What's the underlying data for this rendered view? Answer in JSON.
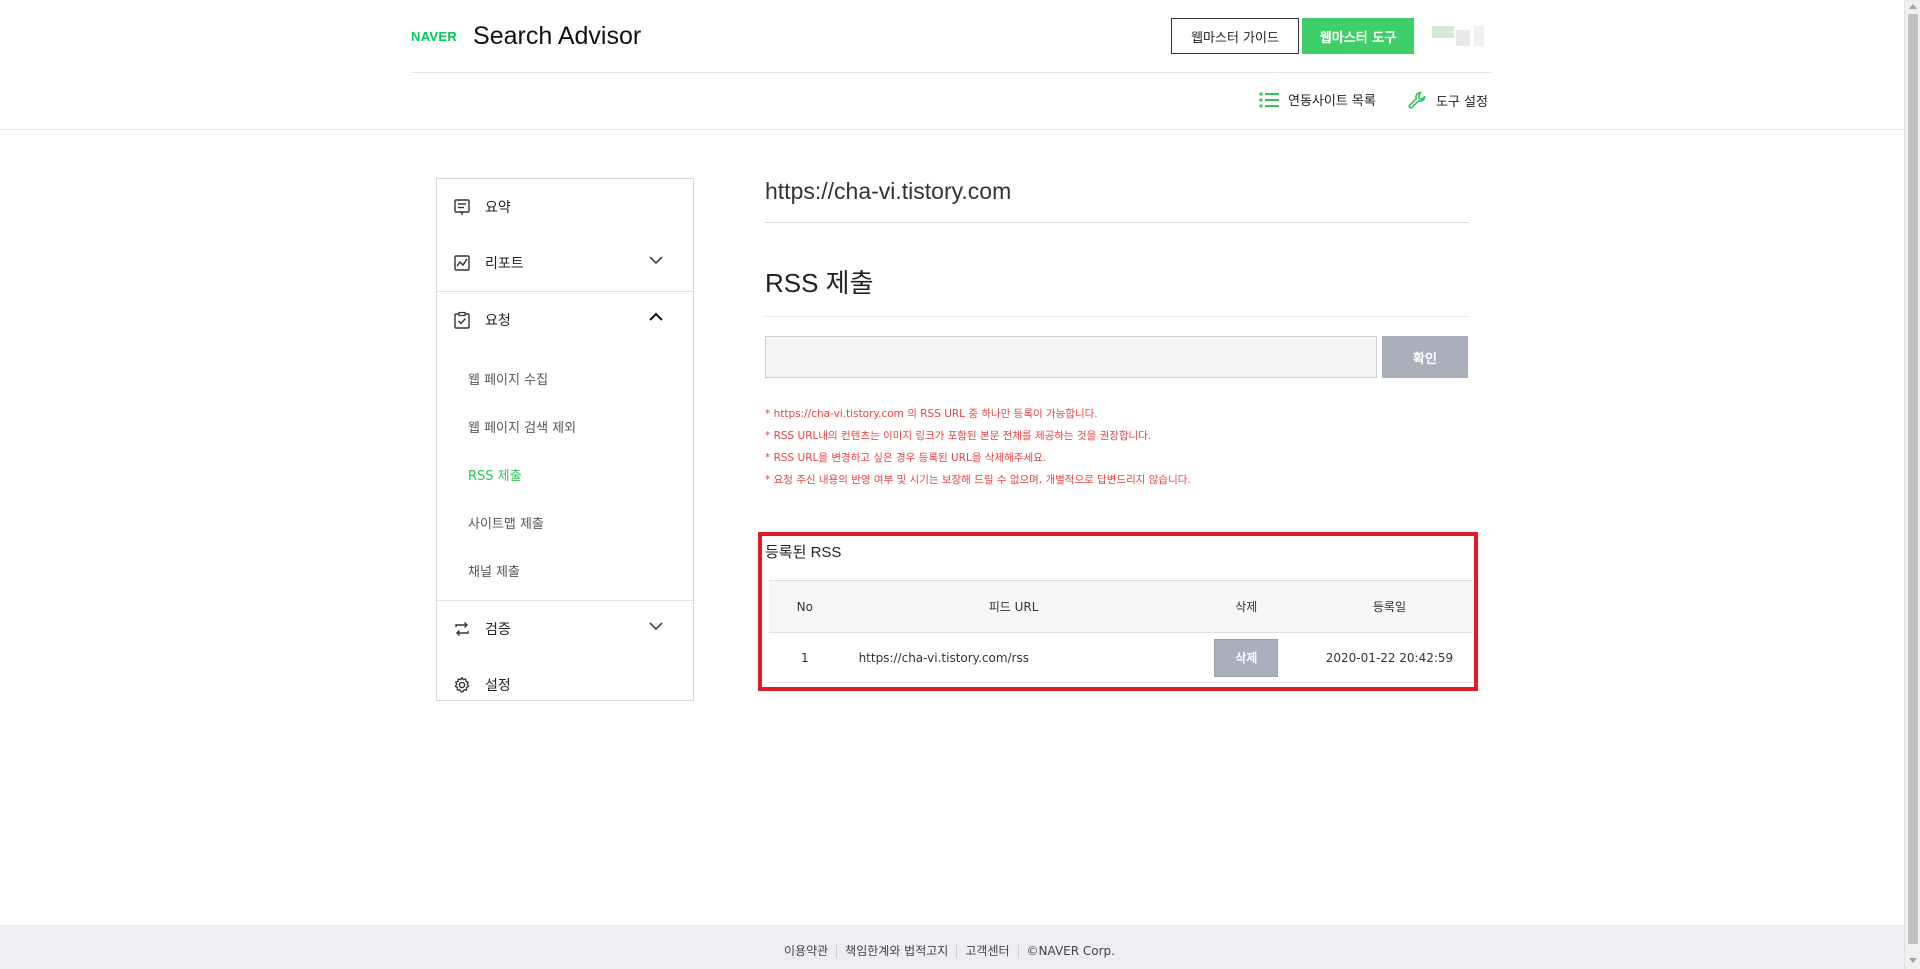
{
  "header": {
    "logo_text": "NAVER",
    "app_title": "Search Advisor",
    "guide_button": "웹마스터 가이드",
    "tools_button": "웹마스터 도구",
    "sites_link": "연동사이트 목록",
    "settings_link": "도구 설정"
  },
  "sidebar": {
    "items": [
      {
        "label": "요약",
        "icon": "summary-icon"
      },
      {
        "label": "리포트",
        "icon": "report-icon"
      },
      {
        "label": "요청",
        "icon": "request-icon"
      },
      {
        "label": "검증",
        "icon": "verify-icon"
      },
      {
        "label": "설정",
        "icon": "gear-icon"
      }
    ],
    "sub_items": [
      {
        "label": "웹 페이지 수집"
      },
      {
        "label": "웹 페이지 검색 제외"
      },
      {
        "label": "RSS 제출"
      },
      {
        "label": "사이트맵 제출"
      },
      {
        "label": "채널 제출"
      }
    ]
  },
  "main": {
    "site_url": "https://cha-vi.tistory.com",
    "page_title": "RSS 제출",
    "input_value": "",
    "confirm_button": "확인",
    "notes": [
      "* https://cha-vi.tistory.com 의 RSS URL 중 하나만 등록이 가능합니다.",
      "* RSS URL내의 컨텐츠는 이미지 링크가 포함된 본문 전체를 제공하는 것을 권장합니다.",
      "* RSS URL을 변경하고 싶은 경우 등록된 URL을 삭제해주세요.",
      "* 요청 주신 내용의 반영 여부 및 시기는 보장해 드릴 수 없으며, 개별적으로 답변드리지 않습니다."
    ]
  },
  "registered": {
    "title": "등록된 RSS",
    "columns": [
      "No",
      "피드 URL",
      "삭제",
      "등록일"
    ],
    "rows": [
      {
        "no": "1",
        "url": "https://cha-vi.tistory.com/rss",
        "delete_label": "삭제",
        "date": "2020-01-22 20:42:59"
      }
    ]
  },
  "footer": {
    "links": [
      "이용약관",
      "책임한계와 법적고지",
      "고객센터",
      "©NAVER Corp."
    ]
  },
  "colors": {
    "brand_green": "#03c75a",
    "highlight_red": "#e11a2a",
    "note_red": "#e64444",
    "button_gray": "#a9b0bb"
  }
}
